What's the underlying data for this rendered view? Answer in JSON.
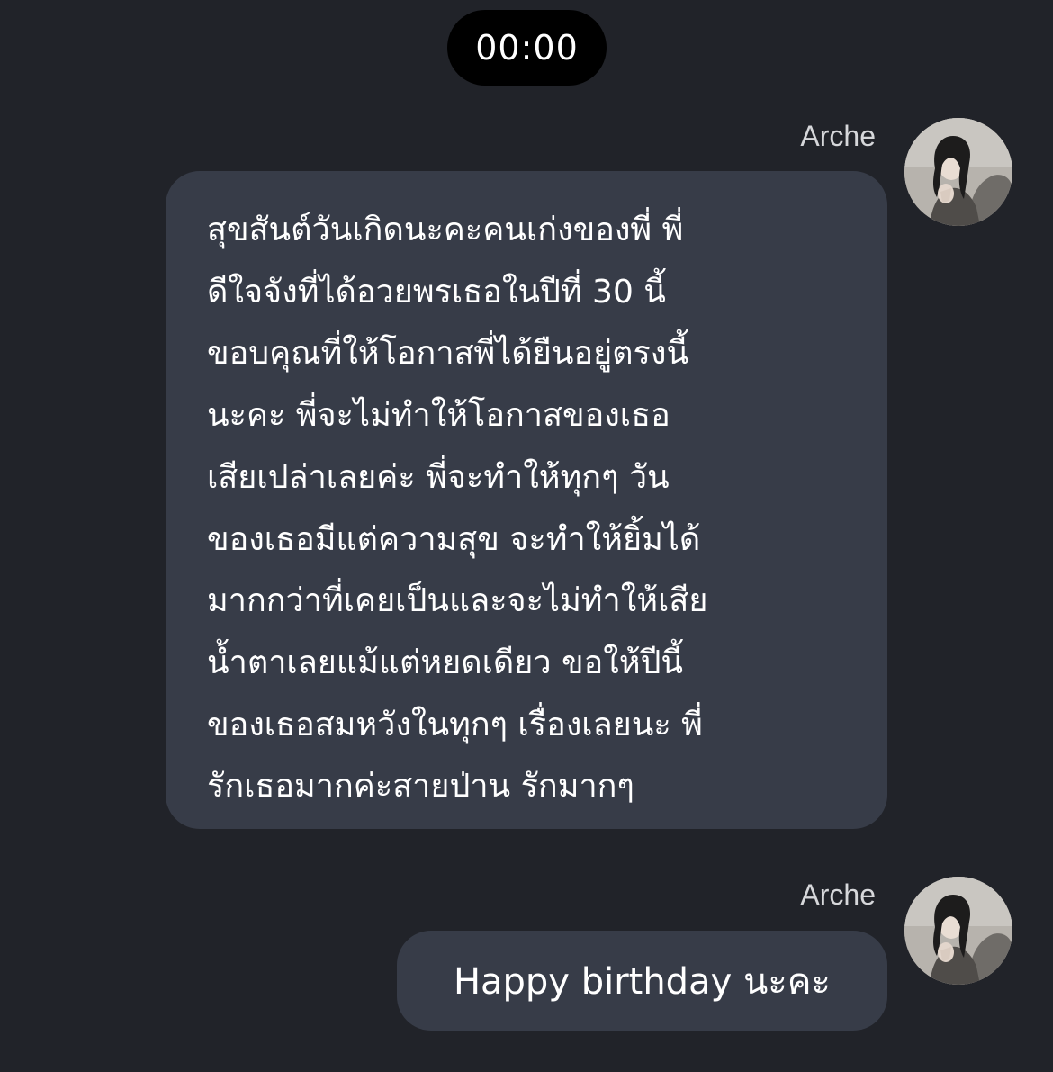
{
  "time_marker": "00:00",
  "messages": [
    {
      "sender": "Arche",
      "avatar_icon": "avatar-photo",
      "lines": [
        "สุขสันต์วันเกิดนะคะคนเก่งของพี่ พี่",
        "ดีใจจังที่ได้อวยพรเธอในปีที่ 30 นี้",
        "ขอบคุณที่ให้โอกาสพี่ได้ยืนอยู่ตรงนี้",
        "นะคะ พี่จะไม่ทำให้โอกาสของเธอ",
        "เสียเปล่าเลยค่ะ พี่จะทำให้ทุกๆ วัน",
        "ของเธอมีแต่ความสุข จะทำให้ยิ้มได้",
        "มากกว่าที่เคยเป็นและจะไม่ทำให้เสีย",
        "น้ำตาเลยแม้แต่หยดเดียว ขอให้ปีนี้",
        "ของเธอสมหวังในทุกๆ เรื่องเลยนะ พี่",
        "รักเธอมากค่ะสายป่าน รักมากๆ"
      ]
    },
    {
      "sender": "Arche",
      "avatar_icon": "avatar-photo",
      "text": "Happy birthday นะคะ"
    }
  ],
  "colors": {
    "background": "#212329",
    "bubble": "#373c48",
    "time_pill": "#000000",
    "sender_name": "#d6d7da"
  }
}
